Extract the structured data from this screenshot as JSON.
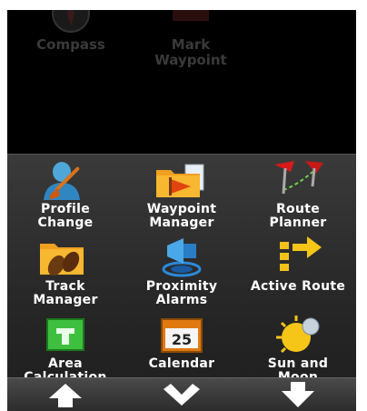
{
  "background_apps": [
    {
      "id": "compass",
      "label": "Compass",
      "icon": "compass-icon"
    },
    {
      "id": "mark-waypoint",
      "label": "Mark\nWaypoint",
      "icon": "flag-icon"
    }
  ],
  "apps": [
    {
      "id": "profile-change",
      "line1": "Profile",
      "line2": "Change",
      "icon": "profile-brush-icon"
    },
    {
      "id": "waypoint-manager",
      "line1": "Waypoint",
      "line2": "Manager",
      "icon": "folder-flag-icon"
    },
    {
      "id": "route-planner",
      "line1": "Route",
      "line2": "Planner",
      "icon": "route-pins-icon"
    },
    {
      "id": "track-manager",
      "line1": "Track",
      "line2": "Manager",
      "icon": "folder-footprints-icon"
    },
    {
      "id": "proximity-alarms",
      "line1": "Proximity",
      "line2": "Alarms",
      "icon": "speaker-alarm-icon"
    },
    {
      "id": "active-route",
      "line1": "Active Route",
      "line2": "",
      "icon": "route-arrow-icon"
    },
    {
      "id": "area-calculation",
      "line1": "Area",
      "line2": "Calculation",
      "icon": "area-icon"
    },
    {
      "id": "calendar",
      "line1": "Calendar",
      "line2": "",
      "icon": "calendar-icon",
      "date": "25"
    },
    {
      "id": "sun-and-moon",
      "line1": "Sun and",
      "line2": "Moon",
      "icon": "sun-moon-icon"
    }
  ],
  "nav": [
    {
      "id": "scroll-up",
      "icon": "arrow-up-icon"
    },
    {
      "id": "collapse",
      "icon": "chevron-down-icon"
    },
    {
      "id": "scroll-down",
      "icon": "arrow-down-icon"
    }
  ],
  "colors": {
    "drawer_bg": "#2b2b2b",
    "label": "#ffffff",
    "nav_bg": "#3a3a3a"
  }
}
